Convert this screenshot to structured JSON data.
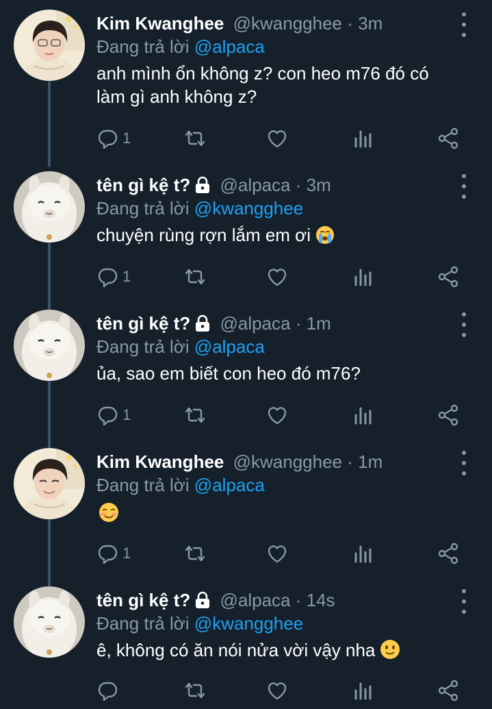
{
  "tweets": [
    {
      "name": "Kim Kwanghee",
      "locked": false,
      "handle": "@kwangghee",
      "separator": "·",
      "time": "3m",
      "reply_prefix": "Đang trả lời",
      "reply_to": "@alpaca",
      "text": "anh mình ổn không z? con heo m76 đó có làm gì anh không z?",
      "emoji": "",
      "reply_count": "1",
      "avatar": "person-avatar"
    },
    {
      "name": "tên gì kệ t?",
      "locked": true,
      "handle": "@alpaca",
      "separator": "·",
      "time": "3m",
      "reply_prefix": "Đang trả lời",
      "reply_to": "@kwangghee",
      "text": "chuyện rùng rợn lắm em ơi",
      "emoji": "crying-face",
      "reply_count": "1",
      "avatar": "alpaca-avatar"
    },
    {
      "name": "tên gì kệ t?",
      "locked": true,
      "handle": "@alpaca",
      "separator": "·",
      "time": "1m",
      "reply_prefix": "Đang trả lời",
      "reply_to": "@alpaca",
      "text": "ủa, sao em biết con heo đó m76?",
      "emoji": "",
      "reply_count": "1",
      "avatar": "alpaca-avatar"
    },
    {
      "name": "Kim Kwanghee",
      "locked": false,
      "handle": "@kwangghee",
      "separator": "·",
      "time": "1m",
      "reply_prefix": "Đang trả lời",
      "reply_to": "@alpaca",
      "text": "",
      "emoji": "smiling-blush-face",
      "reply_count": "1",
      "avatar": "person-avatar"
    },
    {
      "name": "tên gì kệ t?",
      "locked": true,
      "handle": "@alpaca",
      "separator": "·",
      "time": "14s",
      "reply_prefix": "Đang trả lời",
      "reply_to": "@kwangghee",
      "text": "ê, không có ăn nói nửa vời vậy nha",
      "emoji": "slightly-smiling-face",
      "reply_count": "",
      "avatar": "alpaca-avatar"
    }
  ],
  "theme": {
    "background": "#15202b",
    "muted": "#8899a6",
    "accent": "#1da1f2",
    "thread_line": "#3d5466"
  },
  "icons": [
    "reply-icon",
    "retweet-icon",
    "like-icon",
    "analytics-icon",
    "share-icon",
    "more-menu-icon",
    "lock-icon"
  ]
}
